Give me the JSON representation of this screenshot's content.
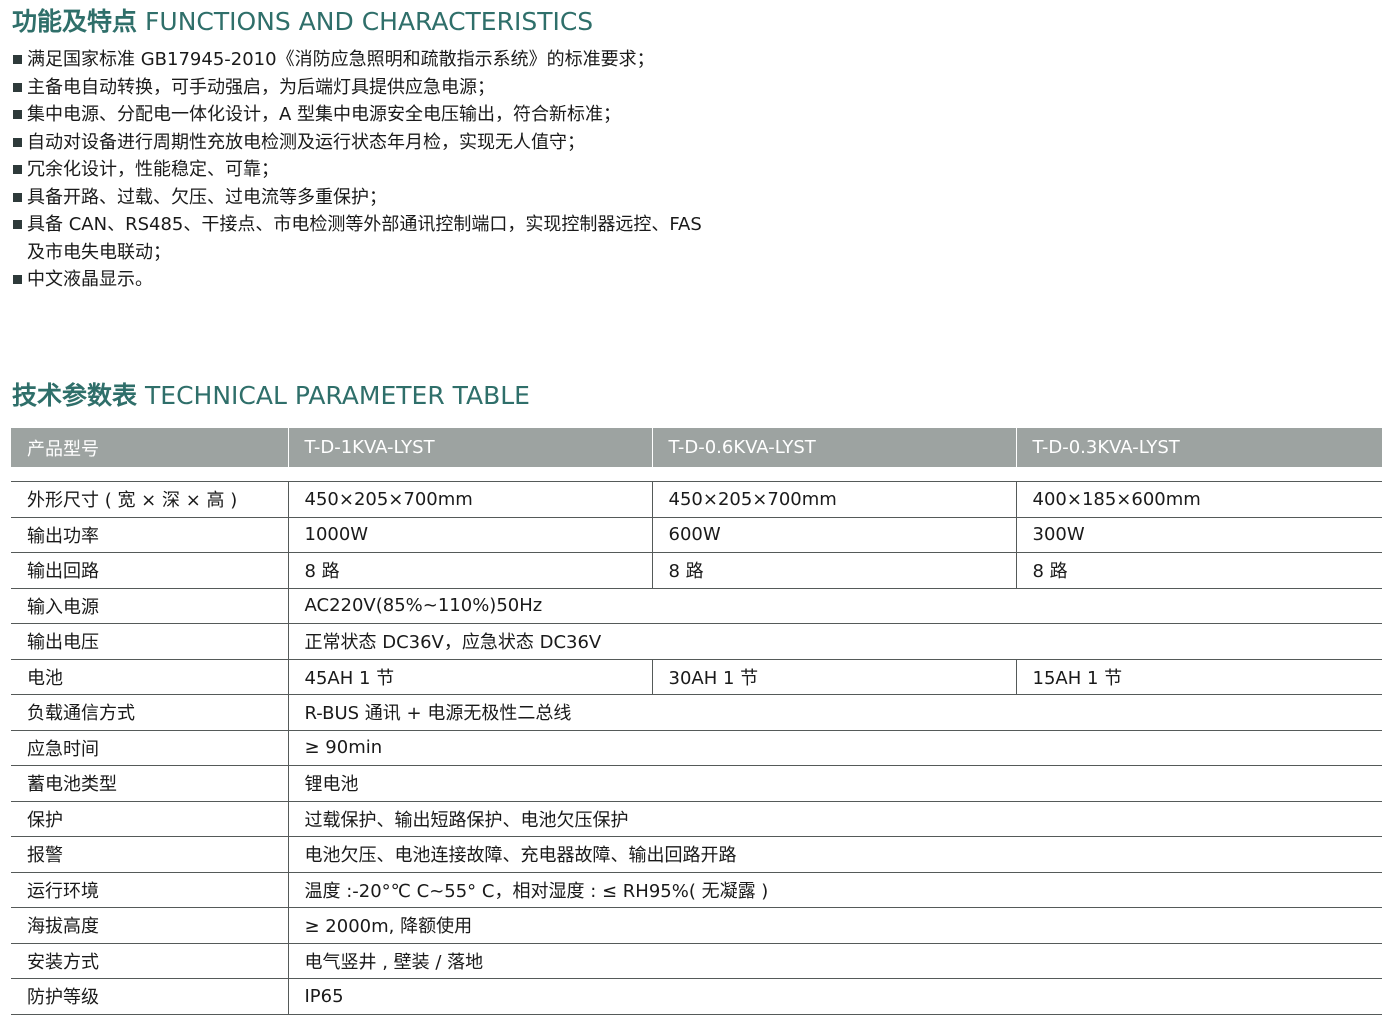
{
  "functions": {
    "title_cn": "功能及特点",
    "title_en": "FUNCTIONS AND CHARACTERISTICS",
    "items": [
      "满足国家标准 GB17945-2010《消防应急照明和疏散指示系统》的标准要求；",
      "主备电自动转换，可手动强启，为后端灯具提供应急电源；",
      "集中电源、分配电一体化设计，A 型集中电源安全电压输出，符合新标准；",
      "自动对设备进行周期性充放电检测及运行状态年月检，实现无人值守；",
      "冗余化设计，性能稳定、可靠；",
      "具备开路、过载、欠压、过电流等多重保护；",
      "具备 CAN、RS485、干接点、市电检测等外部通讯控制端口，实现控制器远控、FAS\n及市电失电联动；",
      "中文液晶显示。"
    ]
  },
  "params": {
    "title_cn": "技术参数表",
    "title_en": "TECHNICAL PARAMETER TABLE",
    "header": [
      "产品型号",
      "T-D-1KVA-LYST",
      "T-D-0.6KVA-LYST",
      "T-D-0.3KVA-LYST"
    ],
    "rows": [
      {
        "label": "外形尺寸 ( 宽 × 深 × 高 )",
        "values": [
          "450×205×700mm",
          "450×205×700mm",
          "400×185×600mm"
        ]
      },
      {
        "label": "输出功率",
        "values": [
          "1000W",
          "600W",
          "300W"
        ]
      },
      {
        "label": "输出回路",
        "values": [
          "8 路",
          "8 路",
          "8 路"
        ]
      },
      {
        "label": "输入电源",
        "value": "AC220V(85%~110%)50Hz"
      },
      {
        "label": "输出电压",
        "value": "正常状态 DC36V，应急状态 DC36V"
      },
      {
        "label": "电池",
        "values": [
          "45AH 1 节",
          "30AH 1 节",
          "15AH 1 节"
        ]
      },
      {
        "label": "负载通信方式",
        "value": "R-BUS 通讯 + 电源无极性二总线"
      },
      {
        "label": "应急时间",
        "value": "≥ 90min"
      },
      {
        "label": "蓄电池类型",
        "value": "锂电池"
      },
      {
        "label": "保护",
        "value": "过载保护、输出短路保护、电池欠压保护"
      },
      {
        "label": "报警",
        "value": "电池欠压、电池连接故障、充电器故障、输出回路开路"
      },
      {
        "label": "运行环境",
        "value": "温度 :-20°℃ C~55° C，相对湿度 : ≤ RH95%( 无凝露 )"
      },
      {
        "label": "海拔高度",
        "value": "≥ 2000m, 降额使用"
      },
      {
        "label": "安装方式",
        "value": "电气竖井 , 壁装 / 落地"
      },
      {
        "label": "防护等级",
        "value": "IP65"
      }
    ]
  }
}
